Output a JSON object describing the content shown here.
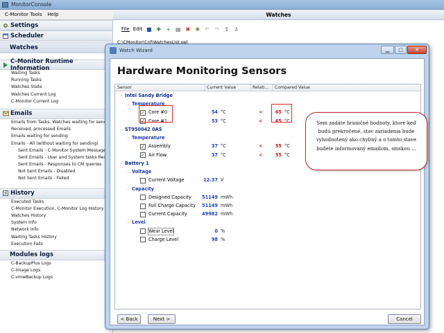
{
  "app": {
    "title": "MonitorConsole",
    "menus": [
      "C-Monitor Tools",
      "Help"
    ]
  },
  "sidebar": {
    "settings": "Settings",
    "scheduler": "Scheduler",
    "watches": "Watches",
    "runtime": {
      "title": "C-Monitor Runtime Information",
      "items": [
        "Waiting Tasks",
        "Running Tasks",
        "Watches State",
        "Watches Current Log",
        "C-Monitor Current Log"
      ]
    },
    "emails": {
      "title": "Emails",
      "items": [
        {
          "label": "Emails from Tasks, Watches waiting for sending",
          "sub": false
        },
        {
          "label": "Received, processed Emails",
          "sub": false
        },
        {
          "label": "Emails waiting for sending",
          "sub": false
        },
        {
          "label": "Emails - All (without waiting for sending)",
          "sub": false
        },
        {
          "label": "Sent Emails - C-Monitor System Messages",
          "sub": true
        },
        {
          "label": "Sent Emails - User and System tasks Results",
          "sub": true
        },
        {
          "label": "Sent Emails - Responses to CM queries",
          "sub": true
        },
        {
          "label": "Not Sent Emails - Disabled",
          "sub": true
        },
        {
          "label": "Not Sent Emails - Failed",
          "sub": true
        }
      ]
    },
    "history": {
      "title": "History",
      "items": [
        "Executed Tasks",
        "C-Monitor Execution, C-Monitor Log History",
        "Watches History",
        "System Info",
        "Network Info",
        "Waiting Tasks History",
        "Execution Fails"
      ]
    },
    "modules": {
      "title": "Modules logs",
      "items": [
        "C-BackupPlus Logs",
        "C-Image Logs",
        "C-vmwBackup Logs"
      ]
    }
  },
  "main": {
    "title": "Watches",
    "toolbar": {
      "file": "File",
      "edit": "Edit"
    },
    "path": "C:\\CMonitor\\Cnf\\WatchesList.swl"
  },
  "wizard": {
    "title": "Watch Wizard",
    "heading": "Hardware Monitoring Sensors",
    "columns": {
      "sensor": "Sensor",
      "current": "Current Value",
      "relation": "Relati...",
      "compared": "Compared Value"
    },
    "rows": [
      {
        "level": 0,
        "label": "Intel Sandy Bridge",
        "kind": "group",
        "expand": "-"
      },
      {
        "level": 1,
        "label": "Temperature",
        "kind": "cat",
        "expand": "-"
      },
      {
        "level": 2,
        "label": "Core #0",
        "kind": "sensor",
        "checked": true,
        "value": "54",
        "unit": "°C",
        "relation": "<",
        "compared": "65",
        "cunit": "°C",
        "hl": true
      },
      {
        "level": 2,
        "label": "Core #1",
        "kind": "sensor",
        "checked": true,
        "value": "53",
        "unit": "°C",
        "relation": "<",
        "compared": "65",
        "cunit": "°C",
        "hl": true
      },
      {
        "level": 0,
        "label": "ST950042 0AS",
        "kind": "group",
        "expand": "-"
      },
      {
        "level": 1,
        "label": "Temperature",
        "kind": "cat",
        "expand": "-"
      },
      {
        "level": 2,
        "label": "Assembly",
        "kind": "sensor",
        "checked": true,
        "value": "37",
        "unit": "°C",
        "relation": "<",
        "compared": "55",
        "cunit": "°C"
      },
      {
        "level": 2,
        "label": "Air Flow",
        "kind": "sensor",
        "checked": true,
        "value": "37",
        "unit": "°C",
        "relation": "<",
        "compared": "55",
        "cunit": "°C"
      },
      {
        "level": 0,
        "label": "Battery 1",
        "kind": "group",
        "expand": "-"
      },
      {
        "level": 1,
        "label": "Voltage",
        "kind": "cat",
        "expand": "-"
      },
      {
        "level": 2,
        "label": "Current Voltage",
        "kind": "sensor",
        "checked": false,
        "value": "12.37",
        "unit": "V"
      },
      {
        "level": 1,
        "label": "Capacity",
        "kind": "cat",
        "expand": "-"
      },
      {
        "level": 2,
        "label": "Designed Capacity",
        "kind": "sensor",
        "checked": false,
        "value": "51149",
        "unit": "mWh"
      },
      {
        "level": 2,
        "label": "Full Charge Capacity",
        "kind": "sensor",
        "checked": false,
        "value": "51149",
        "unit": "mWh"
      },
      {
        "level": 2,
        "label": "Current Capacity",
        "kind": "sensor",
        "checked": false,
        "value": "49982",
        "unit": "mWh"
      },
      {
        "level": 1,
        "label": "Level",
        "kind": "cat",
        "expand": "-"
      },
      {
        "level": 2,
        "label": "Wear Level",
        "kind": "sensor",
        "checked": false,
        "value": "0",
        "unit": "%",
        "focus": true
      },
      {
        "level": 2,
        "label": "Charge Level",
        "kind": "sensor",
        "checked": false,
        "value": "98",
        "unit": "%"
      }
    ],
    "callout": "Sem zadáte hraničné hodnoty, ktoré keď budú prekročené, stav zariadenia bude vyhodnotený ako chybný a o tomto stave budete informovaný emailom, smskou ...",
    "buttons": {
      "back": "< Back",
      "next": "Next >",
      "cancel": "Cancel"
    }
  },
  "colors": {
    "value": "#1e3eb8",
    "alarm": "#c81616",
    "group": "#1f3aa8"
  }
}
